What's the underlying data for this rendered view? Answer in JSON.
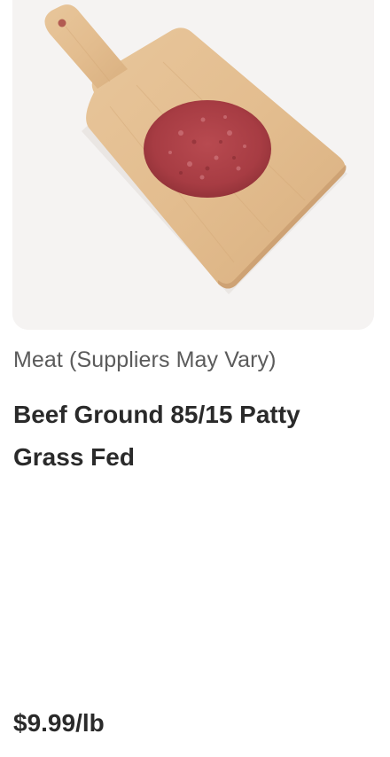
{
  "product": {
    "image_icon": "beef-patty-on-cutting-board-image",
    "supplier": "Meat (Suppliers May Vary)",
    "name": "Beef Ground 85/15 Patty Grass Fed",
    "price": "$9.99/lb"
  }
}
